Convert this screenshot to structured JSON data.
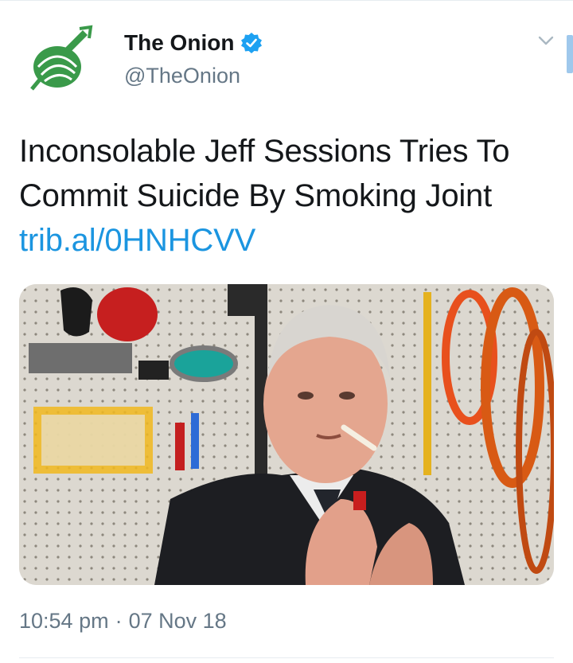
{
  "tweet": {
    "author_name": "The Onion",
    "handle": "@TheOnion",
    "text": "Inconsolable Jeff Sessions Tries To Commit Suicide By Smoking Joint",
    "link": "trib.al/0HNHCVV",
    "time": "10:54 pm",
    "separator": "·",
    "date": "07 Nov 18"
  },
  "icons": {
    "avatar": "onion-logo-icon",
    "verified": "verified-badge-icon",
    "menu": "chevron-down-icon"
  },
  "colors": {
    "brand_green": "#2e8b3e",
    "link_blue": "#1b95e0",
    "verified_blue": "#1da1f2",
    "secondary_text": "#657786"
  }
}
